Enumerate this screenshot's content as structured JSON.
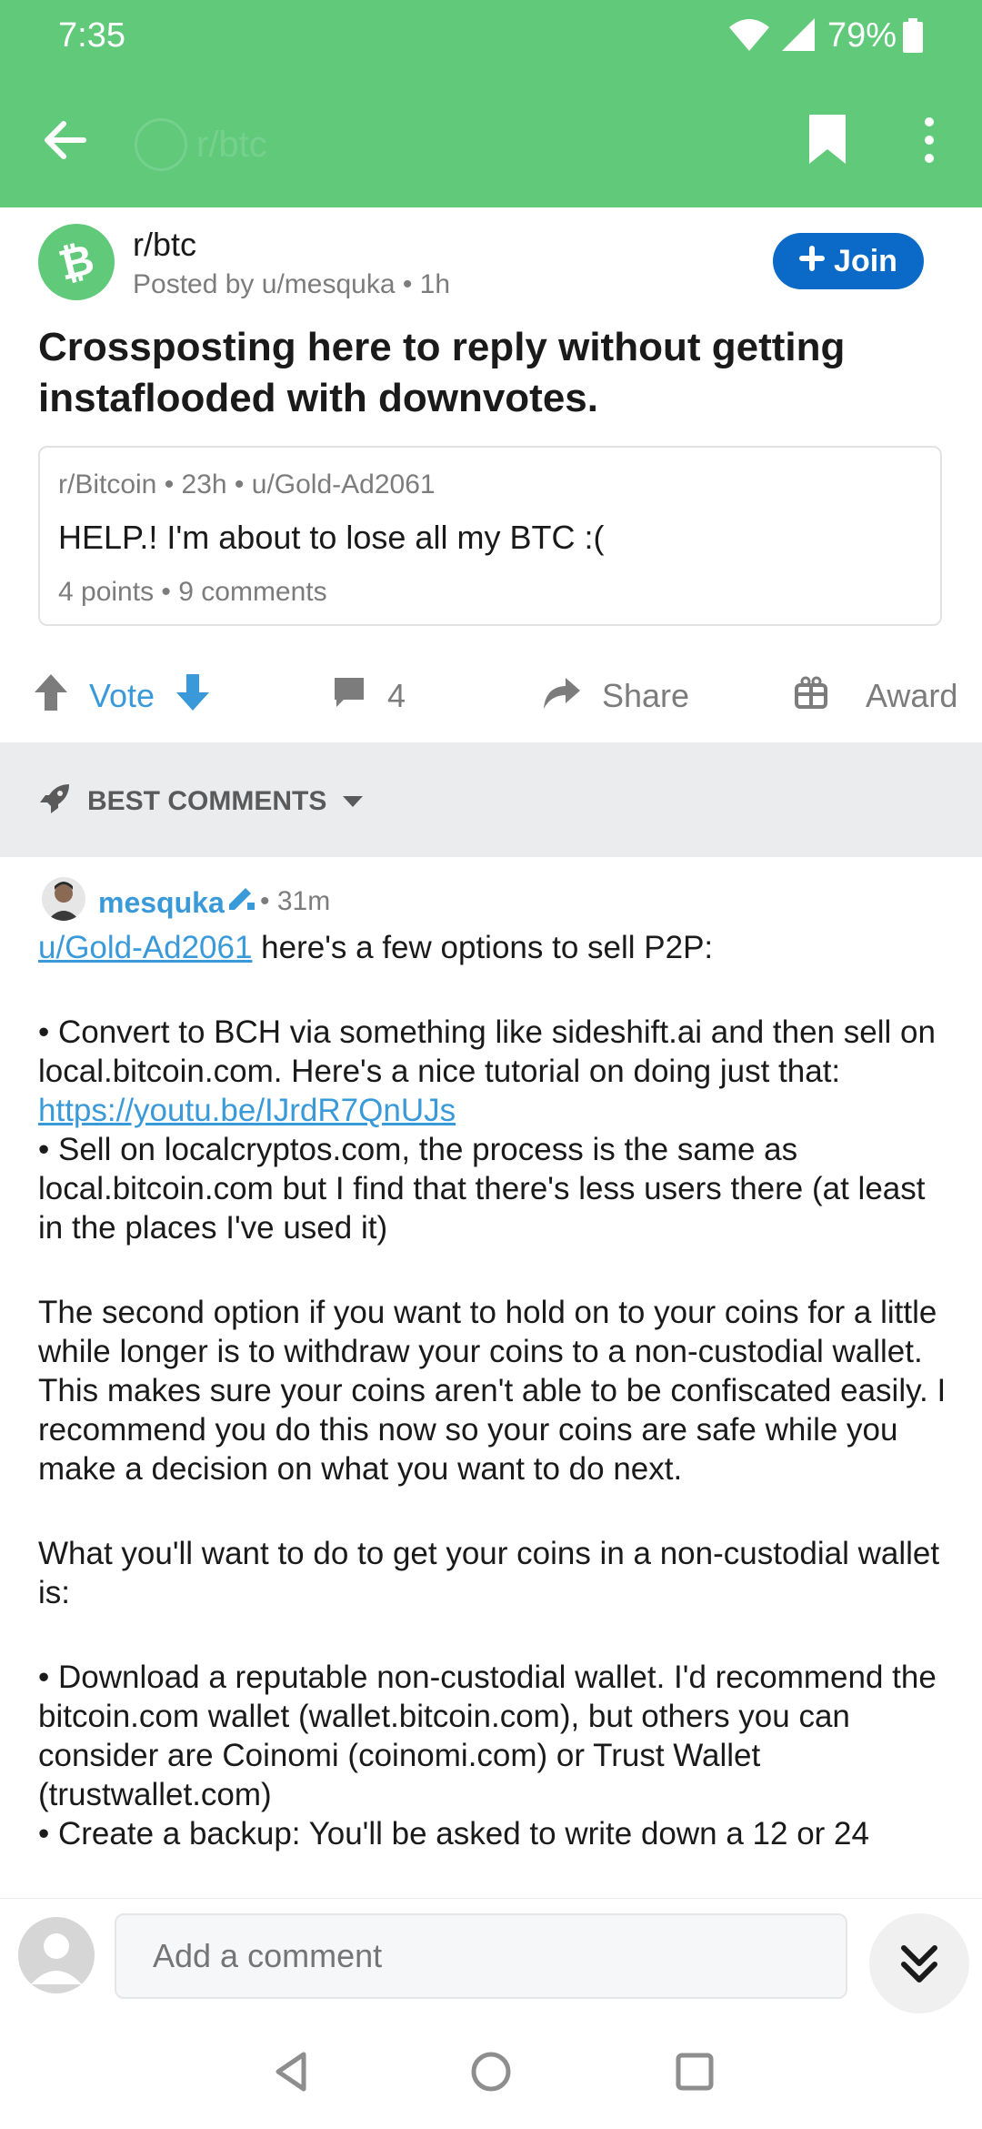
{
  "colors": {
    "accent": "#60c97a",
    "join": "#0b69c7",
    "vote": "#3a9ad9",
    "link": "#3a9ad9"
  },
  "status_bar": {
    "time": "7:35",
    "battery": "79%"
  },
  "toolbar": {
    "ghost_title": "r/btc"
  },
  "post": {
    "subreddit": "r/btc",
    "posted_by": "Posted by u/mesquka • 1h",
    "join_label": "Join",
    "title": "Crossposting here to reply without getting instaflooded with downvotes.",
    "crosspost": {
      "meta": "r/Bitcoin • 23h • u/Gold-Ad2061",
      "title": "HELP.! I'm about to lose all my BTC :(",
      "stats": "4 points • 9 comments"
    },
    "actions": {
      "vote": "Vote",
      "comments": "4",
      "share": "Share",
      "award": "Award"
    }
  },
  "sort": {
    "label": "BEST COMMENTS"
  },
  "comment": {
    "author": "mesquka",
    "time": "• 31m",
    "mention": "u/Gold-Ad2061",
    "p1_rest": " here's a few options to sell P2P:",
    "bullet1": "• Convert to BCH via something like sideshift.ai and then sell on local.bitcoin.com. Here's a nice tutorial on doing just that:",
    "link1": "https://youtu.be/IJrdR7QnUJs",
    "bullet2": "• Sell on localcryptos.com, the process is the same as local.bitcoin.com but I find that there's less users there (at least in the places I've used it)",
    "p2": "The second option if you want to hold on to your coins for a little while longer is to withdraw your coins to a non-custodial wallet. This makes sure your coins aren't able to be confiscated easily. I recommend you do this now so your coins are safe while you make a decision on what you want to do next.",
    "p3": "What you'll want to do to get your coins in a non-custodial wallet is:",
    "bullet3": "• Download a reputable non-custodial wallet. I'd recommend the bitcoin.com wallet (wallet.bitcoin.com), but others you can consider are Coinomi (coinomi.com) or Trust Wallet (trustwallet.com)",
    "bullet4": "• Create a backup: You'll be asked to write down a 12 or 24"
  },
  "comment_bar": {
    "placeholder": "Add a comment"
  },
  "icons": [
    "wifi-icon",
    "signal-icon",
    "battery-icon",
    "back-arrow-icon",
    "bookmark-icon",
    "more-vert-icon",
    "bitcoin-cash-icon",
    "plus-icon",
    "upvote-icon",
    "downvote-icon",
    "comment-icon",
    "share-icon",
    "award-icon",
    "rocket-icon",
    "chevron-down-icon",
    "avatar",
    "pencil-icon",
    "user-placeholder-icon",
    "double-chevron-down-icon",
    "nav-back-icon",
    "nav-home-icon",
    "nav-recents-icon"
  ]
}
